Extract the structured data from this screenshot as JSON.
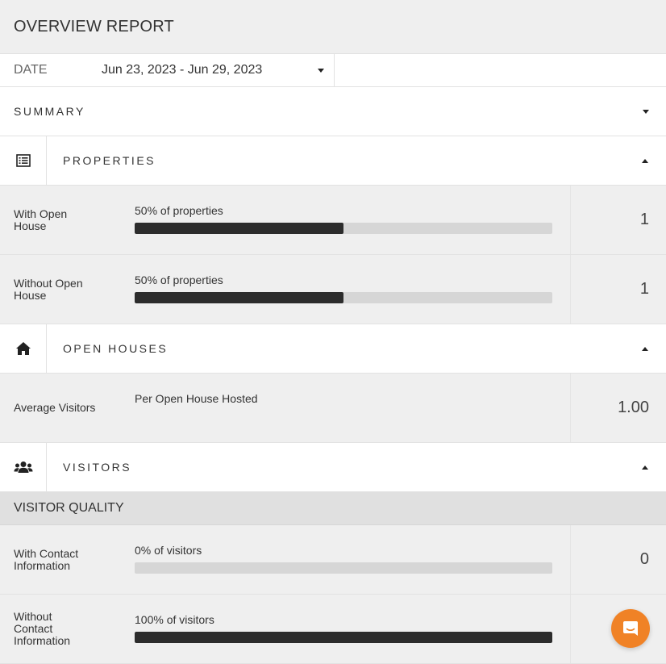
{
  "header": {
    "title": "OVERVIEW REPORT"
  },
  "date_filter": {
    "label": "DATE",
    "value": "Jun 23, 2023 - Jun 29, 2023"
  },
  "summary": {
    "label": "SUMMARY"
  },
  "properties": {
    "label": "PROPERTIES",
    "icon": "list-icon",
    "rows": [
      {
        "label": "With Open House",
        "caption": "50% of properties",
        "percent": 50,
        "value": "1"
      },
      {
        "label": "Without Open House",
        "caption": "50% of properties",
        "percent": 50,
        "value": "1"
      }
    ]
  },
  "open_houses": {
    "label": "OPEN HOUSES",
    "icon": "home-icon",
    "rows": [
      {
        "label": "Average Visitors",
        "caption": "Per Open House Hosted",
        "value": "1.00"
      }
    ]
  },
  "visitors": {
    "label": "VISITORS",
    "icon": "users-icon",
    "subheading": "VISITOR QUALITY",
    "rows": [
      {
        "label": "With Contact Information",
        "caption": "0% of visitors",
        "percent": 0,
        "value": "0"
      },
      {
        "label": "Without Contact Information",
        "caption": "100% of visitors",
        "percent": 100,
        "value": ""
      }
    ]
  },
  "chat": {
    "icon": "chat-icon"
  },
  "colors": {
    "bar_fill": "#2c2c2c",
    "bar_track": "#d6d6d6",
    "chat_accent": "#f08226"
  }
}
